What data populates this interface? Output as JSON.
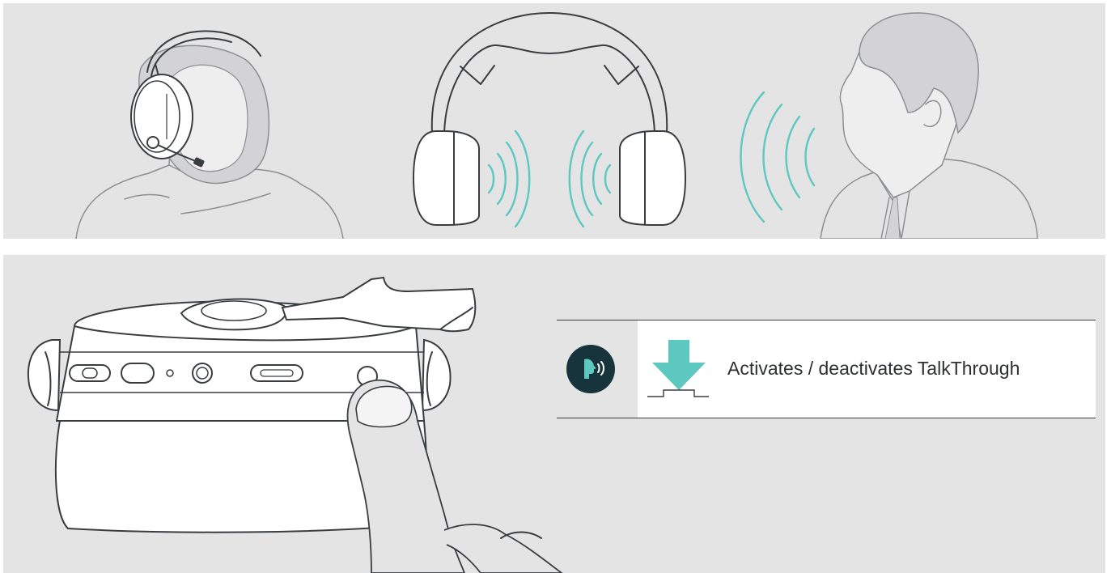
{
  "instructions": {
    "talkthrough_description": "Activates / deactivates TalkThrough"
  },
  "icons": {
    "talkthrough": "talkthrough-icon",
    "press": "press-button-icon"
  },
  "colors": {
    "panel_background": "#e4e4e5",
    "accent_teal": "#5dc8c0",
    "icon_dark": "#17343d",
    "line": "#3a3d40"
  }
}
